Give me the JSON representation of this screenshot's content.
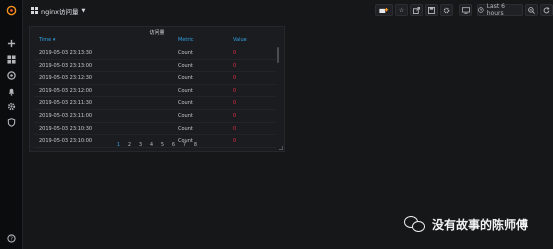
{
  "dashboard": {
    "title": "nginx访问量"
  },
  "toolbar": {
    "time_range_label": "Last 6 hours",
    "icons": [
      "add-panel-icon",
      "star-icon",
      "share-icon",
      "save-icon",
      "settings-icon",
      "tv-mode-icon",
      "clock-icon",
      "zoom-out-icon",
      "refresh-icon"
    ]
  },
  "sidebar": {
    "icons": [
      "grafana-logo-icon",
      "plus-icon",
      "dashboards-grid-icon",
      "explore-compass-icon",
      "alerting-bell-icon",
      "configuration-gear-icon",
      "server-admin-shield-icon",
      "help-icon"
    ]
  },
  "panel": {
    "title": "访问量",
    "columns": {
      "time": "Time ▾",
      "metric": "Metric",
      "value": "Value"
    },
    "rows": [
      {
        "time": "2019-05-03 23:13:30",
        "metric": "Count",
        "value": "0"
      },
      {
        "time": "2019-05-03 23:13:00",
        "metric": "Count",
        "value": "0"
      },
      {
        "time": "2019-05-03 23:12:30",
        "metric": "Count",
        "value": "0"
      },
      {
        "time": "2019-05-03 23:12:00",
        "metric": "Count",
        "value": "0"
      },
      {
        "time": "2019-05-03 23:11:30",
        "metric": "Count",
        "value": "0"
      },
      {
        "time": "2019-05-03 23:11:00",
        "metric": "Count",
        "value": "0"
      },
      {
        "time": "2019-05-03 23:10:30",
        "metric": "Count",
        "value": "0"
      },
      {
        "time": "2019-05-03 23:10:00",
        "metric": "Count",
        "value": "0"
      }
    ],
    "pages": [
      "1",
      "2",
      "3",
      "4",
      "5",
      "6",
      "7",
      "8"
    ],
    "active_page": "1"
  },
  "watermark": {
    "text": "没有故事的陈师傅"
  },
  "colors": {
    "accent": "#33a2e5",
    "value": "#e02f44",
    "background": "#161719"
  }
}
